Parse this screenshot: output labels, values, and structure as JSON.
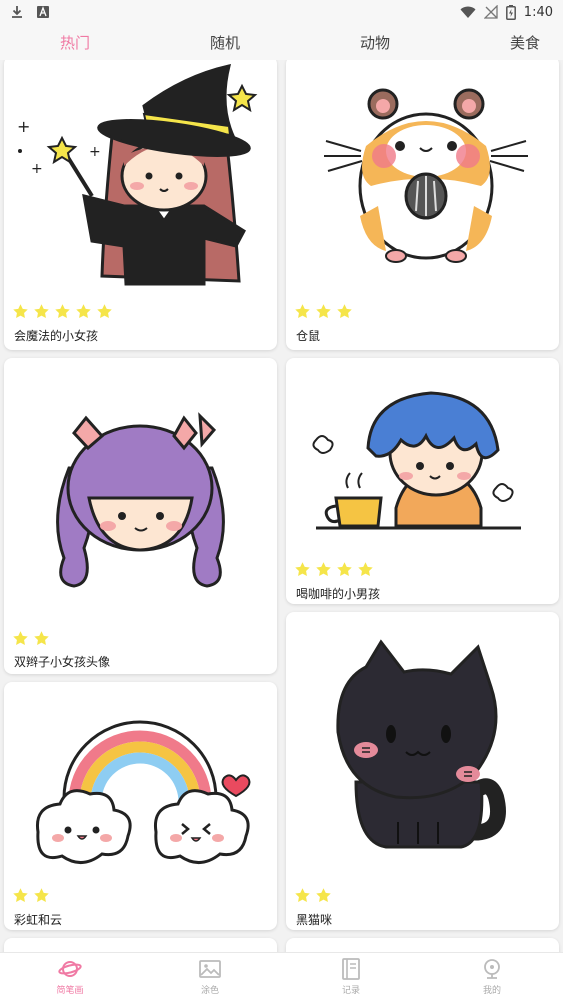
{
  "status_bar": {
    "time": "1:40"
  },
  "tabs": [
    {
      "label": "热门",
      "active": true
    },
    {
      "label": "随机",
      "active": false
    },
    {
      "label": "动物",
      "active": false
    },
    {
      "label": "美食",
      "active": false
    }
  ],
  "cards": [
    {
      "title": "会魔法的小女孩",
      "stars": 5,
      "icon": "witch-girl-drawing"
    },
    {
      "title": "仓鼠",
      "stars": 3,
      "icon": "hamster-drawing"
    },
    {
      "title": "双辫子小女孩头像",
      "stars": 2,
      "icon": "pigtail-girl-drawing"
    },
    {
      "title": "喝咖啡的小男孩",
      "stars": 4,
      "icon": "coffee-boy-drawing"
    },
    {
      "title": "彩虹和云",
      "stars": 2,
      "icon": "rainbow-clouds-drawing"
    },
    {
      "title": "黑猫咪",
      "stars": 2,
      "icon": "black-cat-drawing"
    }
  ],
  "bottom_nav": [
    {
      "label": "简笔画",
      "active": true,
      "icon": "planet-icon"
    },
    {
      "label": "涂色",
      "active": false,
      "icon": "picture-icon"
    },
    {
      "label": "记录",
      "active": false,
      "icon": "book-icon"
    },
    {
      "label": "我的",
      "active": false,
      "icon": "profile-icon"
    }
  ],
  "colors": {
    "accent": "#f07aa4",
    "star": "#f5e54a"
  }
}
